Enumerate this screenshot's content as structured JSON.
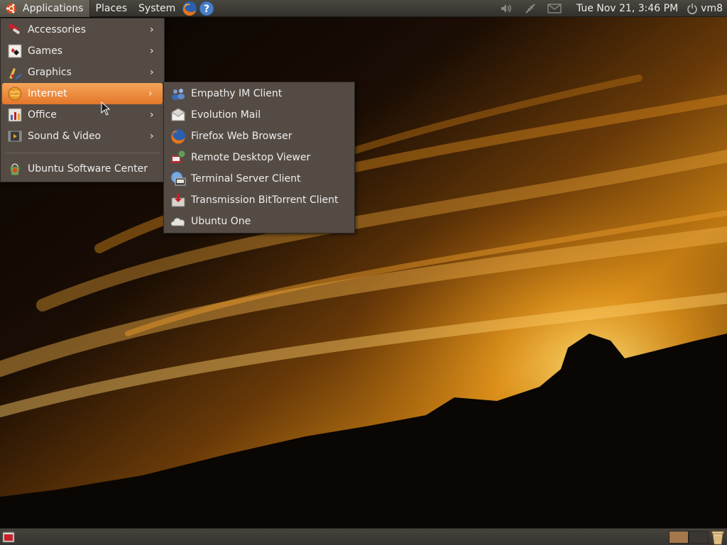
{
  "top_panel": {
    "menus": {
      "applications": "Applications",
      "places": "Places",
      "system": "System"
    },
    "launchers": [
      "firefox-icon",
      "help-icon"
    ],
    "tray_icons": [
      "volume-icon",
      "network-icon",
      "mail-icon"
    ],
    "clock": "Tue Nov 21,  3:46 PM",
    "user": "vm8"
  },
  "applications_menu": {
    "items": [
      {
        "label": "Accessories",
        "icon": "accessories-icon",
        "has_submenu": true
      },
      {
        "label": "Games",
        "icon": "games-icon",
        "has_submenu": true
      },
      {
        "label": "Graphics",
        "icon": "graphics-icon",
        "has_submenu": true
      },
      {
        "label": "Internet",
        "icon": "internet-icon",
        "has_submenu": true,
        "active": true
      },
      {
        "label": "Office",
        "icon": "office-icon",
        "has_submenu": true
      },
      {
        "label": "Sound & Video",
        "icon": "sound-video-icon",
        "has_submenu": true
      }
    ],
    "software_center": "Ubuntu Software Center"
  },
  "internet_submenu": {
    "items": [
      {
        "label": "Empathy IM Client",
        "icon": "empathy-icon"
      },
      {
        "label": "Evolution Mail",
        "icon": "evolution-icon"
      },
      {
        "label": "Firefox Web Browser",
        "icon": "firefox-icon"
      },
      {
        "label": "Remote Desktop Viewer",
        "icon": "remote-desktop-icon"
      },
      {
        "label": "Terminal Server Client",
        "icon": "terminal-server-icon"
      },
      {
        "label": "Transmission BitTorrent Client",
        "icon": "transmission-icon"
      },
      {
        "label": "Ubuntu One",
        "icon": "ubuntu-one-icon"
      }
    ]
  },
  "colors": {
    "panel": "#3c3a34",
    "menu_bg": "#544b44",
    "highlight": "#f0883a",
    "text": "#ededed"
  }
}
